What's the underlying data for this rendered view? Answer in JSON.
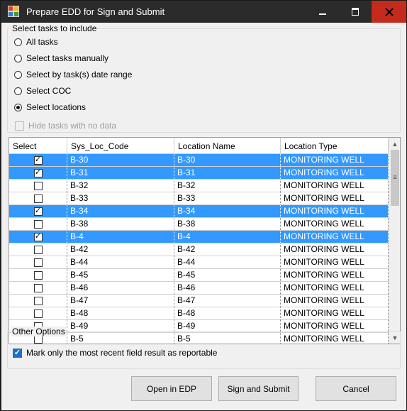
{
  "window": {
    "title": "Prepare EDD for Sign and Submit"
  },
  "task_group": {
    "legend": "Select tasks to include",
    "options": [
      {
        "label": "All tasks",
        "selected": false
      },
      {
        "label": "Select tasks manually",
        "selected": false
      },
      {
        "label": "Select by task(s) date range",
        "selected": false
      },
      {
        "label": "Select COC",
        "selected": false
      },
      {
        "label": "Select locations",
        "selected": true
      }
    ],
    "hide_no_data": {
      "label": "Hide tasks with no data",
      "checked": false,
      "enabled": false
    }
  },
  "grid": {
    "columns": [
      "Select",
      "Sys_Loc_Code",
      "Location Name",
      "Location Type"
    ],
    "rows": [
      {
        "checked": true,
        "selected": true,
        "code": "B-30",
        "name": "B-30",
        "type": "MONITORING WELL"
      },
      {
        "checked": true,
        "selected": true,
        "code": "B-31",
        "name": "B-31",
        "type": "MONITORING WELL"
      },
      {
        "checked": false,
        "selected": false,
        "code": "B-32",
        "name": "B-32",
        "type": "MONITORING WELL"
      },
      {
        "checked": false,
        "selected": false,
        "code": "B-33",
        "name": "B-33",
        "type": "MONITORING WELL"
      },
      {
        "checked": true,
        "selected": true,
        "code": "B-34",
        "name": "B-34",
        "type": "MONITORING WELL"
      },
      {
        "checked": false,
        "selected": false,
        "code": "B-38",
        "name": "B-38",
        "type": "MONITORING WELL"
      },
      {
        "checked": true,
        "selected": true,
        "code": "B-4",
        "name": "B-4",
        "type": "MONITORING WELL"
      },
      {
        "checked": false,
        "selected": false,
        "code": "B-42",
        "name": "B-42",
        "type": "MONITORING WELL"
      },
      {
        "checked": false,
        "selected": false,
        "code": "B-44",
        "name": "B-44",
        "type": "MONITORING WELL"
      },
      {
        "checked": false,
        "selected": false,
        "code": "B-45",
        "name": "B-45",
        "type": "MONITORING WELL"
      },
      {
        "checked": false,
        "selected": false,
        "code": "B-46",
        "name": "B-46",
        "type": "MONITORING WELL"
      },
      {
        "checked": false,
        "selected": false,
        "code": "B-47",
        "name": "B-47",
        "type": "MONITORING WELL"
      },
      {
        "checked": false,
        "selected": false,
        "code": "B-48",
        "name": "B-48",
        "type": "MONITORING WELL"
      },
      {
        "checked": false,
        "selected": false,
        "code": "B-49",
        "name": "B-49",
        "type": "MONITORING WELL"
      },
      {
        "checked": false,
        "selected": false,
        "code": "B-5",
        "name": "B-5",
        "type": "MONITORING WELL"
      }
    ]
  },
  "other_options": {
    "legend": "Other Options",
    "recent_result": {
      "label": "Mark only the most recent field result as reportable",
      "checked": true
    }
  },
  "buttons": {
    "open_edp": "Open in EDP",
    "sign_submit": "Sign and Submit",
    "cancel": "Cancel"
  },
  "colors": {
    "selection": "#3399ff",
    "titlebar": "#2b2b2b",
    "close": "#c42b1c"
  }
}
